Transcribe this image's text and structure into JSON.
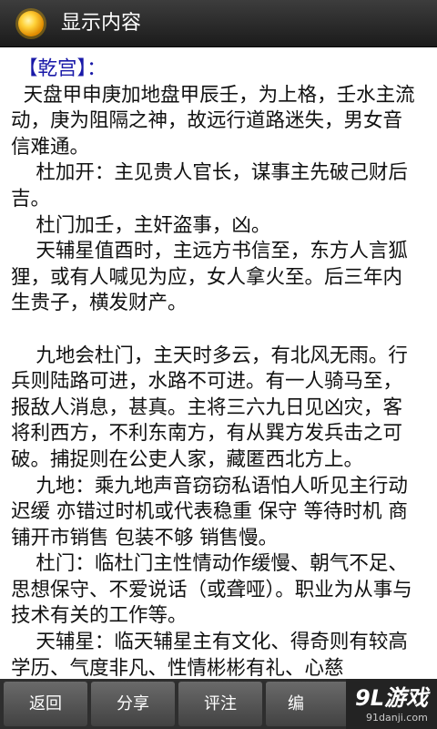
{
  "app": {
    "title": "显示内容"
  },
  "content": {
    "section_title": "【乾宫】：",
    "paragraphs": [
      "  天盘甲申庚加地盘甲辰壬，为上格，壬水主流动，庚为阻隔之神，故远行道路迷失，男女音信难通。",
      "    杜加开：主见贵人官长，谋事主先破己财后吉。",
      "    杜门加壬，主奸盗事，凶。",
      "    天辅星值酉时，主远方书信至，东方人言狐狸，或有人喊见为应，女人拿火至。后三年内生贵子，横发财产。",
      "",
      "    九地会杜门，主天时多云，有北风无雨。行兵则陆路可进，水路不可进。有一人骑马至，报敌人消息，甚真。主将三六九日见凶灾，客将利西方，不利东南方，有从巽方发兵击之可破。捕捉则在公吏人家，藏匿西北方上。",
      "    九地：乘九地声音窃窃私语怕人听见主行动迟缓 亦错过时机或代表稳重 保守 等待时机 商铺开市销售 包装不够 销售慢。",
      "    杜门：临杜门主性情动作缓慢、朝气不足、思想保守、不爱说话（或聋哑）。职业为从事与技术有关的工作等。",
      "    天辅星：临天辅星主有文化、得奇则有较高学历、气度非凡、性情彬彬有礼、心慈"
    ]
  },
  "toolbar": {
    "back_label": "返回",
    "share_label": "分享",
    "note_label": "评注",
    "edit_label": "编"
  },
  "watermark": {
    "logo": "9L游戏",
    "url": "91danji.com"
  },
  "colors": {
    "title_bar": "#2a2a2a",
    "section_title": "#1919a8",
    "button": "#555555"
  }
}
